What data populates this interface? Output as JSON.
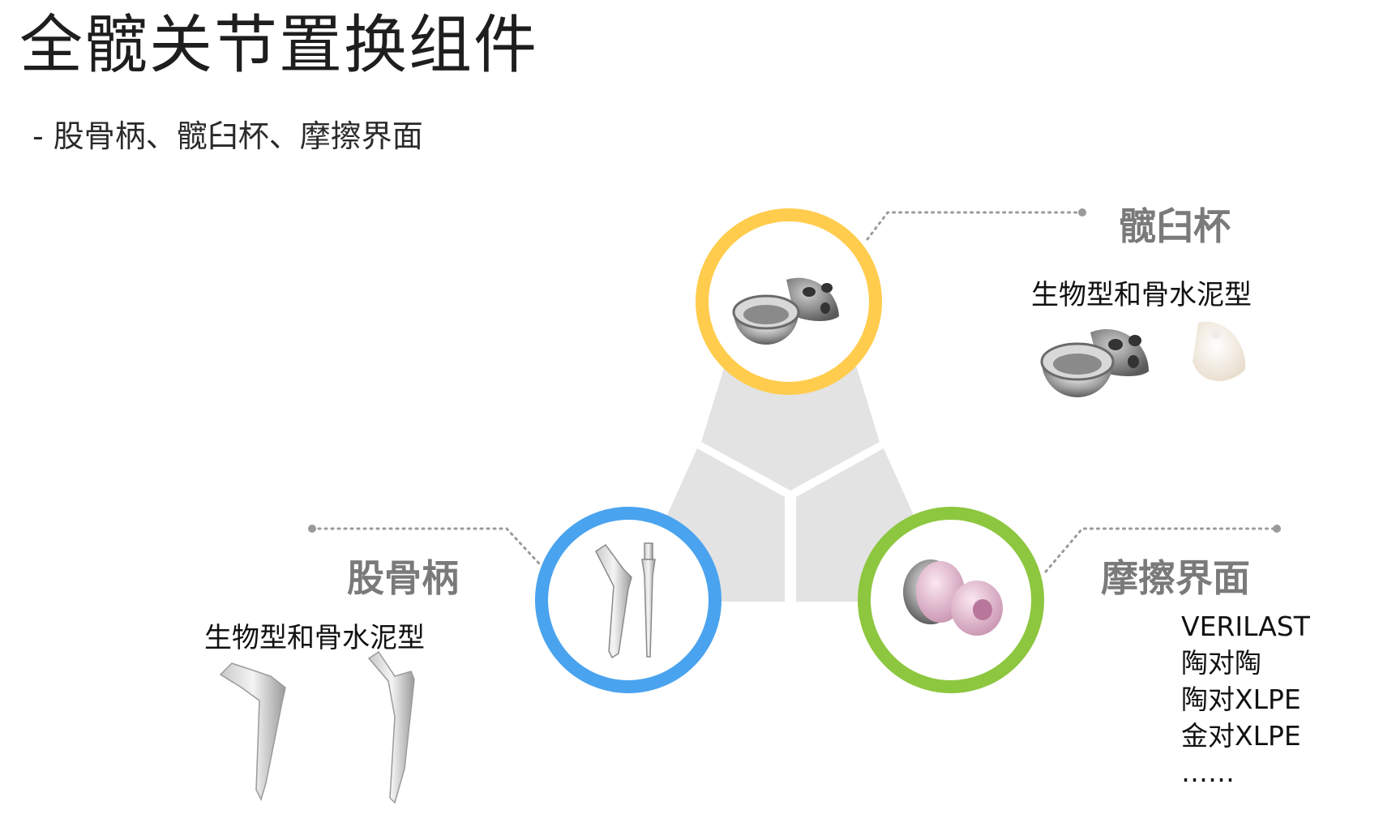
{
  "title": "全髋关节置换组件",
  "subtitle": "- 股骨柄、髋臼杯、摩擦界面",
  "components": {
    "acetabular_cup": {
      "heading": "髋臼杯",
      "description": "生物型和骨水泥型",
      "ring_color": "#FFCC4D"
    },
    "femoral_stem": {
      "heading": "股骨柄",
      "description": "生物型和骨水泥型",
      "ring_color": "#4AA3EE"
    },
    "bearing_surface": {
      "heading": "摩擦界面",
      "items": [
        "VERILAST",
        "陶对陶",
        "陶对XLPE",
        "金对XLPE",
        "……"
      ],
      "ring_color": "#8DC63F"
    }
  },
  "colors": {
    "triangle": "#E3E3E3",
    "leader_line": "#9A9A9A"
  }
}
